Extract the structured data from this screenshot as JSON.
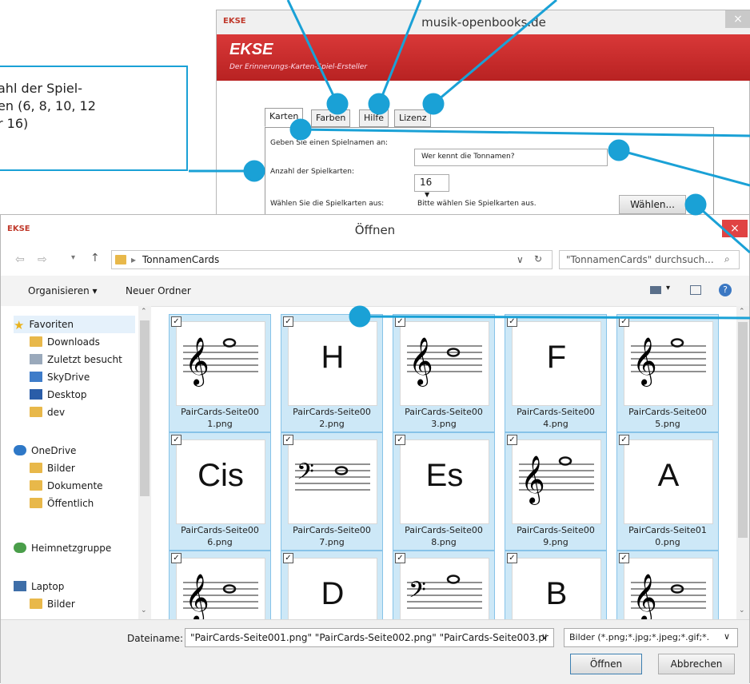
{
  "callout": {
    "lines": [
      "ahl der Spiel-",
      "en (6, 8, 10, 12",
      "r 16)"
    ]
  },
  "ekse": {
    "window_title": "musik-openbooks.de",
    "app_icon": "EKSE",
    "close": "×",
    "brand": "EKSE",
    "tagline": "Der Erinnerungs-Karten-Spiel-Ersteller",
    "tabs": [
      "Karten",
      "Farben",
      "Hilfe",
      "Lizenz"
    ],
    "form": {
      "name_label": "Geben Sie einen Spielnamen an:",
      "name_value": "Wer kennt die Tonnamen?",
      "count_label": "Anzahl der Spielkarten:",
      "count_value": "16",
      "select_label": "Wählen Sie die Spielkarten aus:",
      "select_status": "Bitte wählen Sie Spielkarten aus.",
      "choose_button": "Wählen..."
    }
  },
  "dialog": {
    "title": "Öffnen",
    "app_icon": "EKSE",
    "close": "×",
    "path": [
      "TonnamenCards"
    ],
    "search_placeholder": "\"TonnamenCards\" durchsuch...",
    "toolbar": {
      "organize": "Organisieren ▾",
      "new_folder": "Neuer Ordner"
    },
    "nav": {
      "favorites": "Favoriten",
      "items": [
        "Downloads",
        "Zuletzt besucht",
        "SkyDrive",
        "Desktop",
        "dev"
      ],
      "onedrive": "OneDrive",
      "onedrive_items": [
        "Bilder",
        "Dokumente",
        "Öffentlich"
      ],
      "homegroup": "Heimnetzgruppe",
      "laptop": "Laptop",
      "laptop_items": [
        "Bilder"
      ]
    },
    "files": [
      {
        "cap1": "PairCards-Seite00",
        "cap2": "1.png",
        "kind": "treble",
        "label": ""
      },
      {
        "cap1": "PairCards-Seite00",
        "cap2": "2.png",
        "kind": "text",
        "label": "H"
      },
      {
        "cap1": "PairCards-Seite00",
        "cap2": "3.png",
        "kind": "treble",
        "label": ""
      },
      {
        "cap1": "PairCards-Seite00",
        "cap2": "4.png",
        "kind": "text",
        "label": "F"
      },
      {
        "cap1": "PairCards-Seite00",
        "cap2": "5.png",
        "kind": "treble",
        "label": ""
      },
      {
        "cap1": "PairCards-Seite00",
        "cap2": "6.png",
        "kind": "text",
        "label": "Cis"
      },
      {
        "cap1": "PairCards-Seite00",
        "cap2": "7.png",
        "kind": "bass",
        "label": ""
      },
      {
        "cap1": "PairCards-Seite00",
        "cap2": "8.png",
        "kind": "text",
        "label": "Es"
      },
      {
        "cap1": "PairCards-Seite00",
        "cap2": "9.png",
        "kind": "treble",
        "label": ""
      },
      {
        "cap1": "PairCards-Seite01",
        "cap2": "0.png",
        "kind": "text",
        "label": "A"
      },
      {
        "cap1": "",
        "cap2": "",
        "kind": "treble",
        "label": ""
      },
      {
        "cap1": "",
        "cap2": "",
        "kind": "text",
        "label": "D"
      },
      {
        "cap1": "",
        "cap2": "",
        "kind": "bass",
        "label": ""
      },
      {
        "cap1": "",
        "cap2": "",
        "kind": "text",
        "label": "B"
      },
      {
        "cap1": "",
        "cap2": "",
        "kind": "treble",
        "label": ""
      }
    ],
    "filename_label": "Dateiname:",
    "filename_value": "\"PairCards-Seite001.png\" \"PairCards-Seite002.png\" \"PairCards-Seite003.pr",
    "filter_value": "Bilder (*.png;*.jpg;*.jpeg;*.gif;*.",
    "open_button": "Öffnen",
    "cancel_button": "Abbrechen"
  },
  "colors": {
    "callout": "#1aa1d6",
    "brand_red": "#c8282a",
    "selection": "#cde8f7"
  }
}
